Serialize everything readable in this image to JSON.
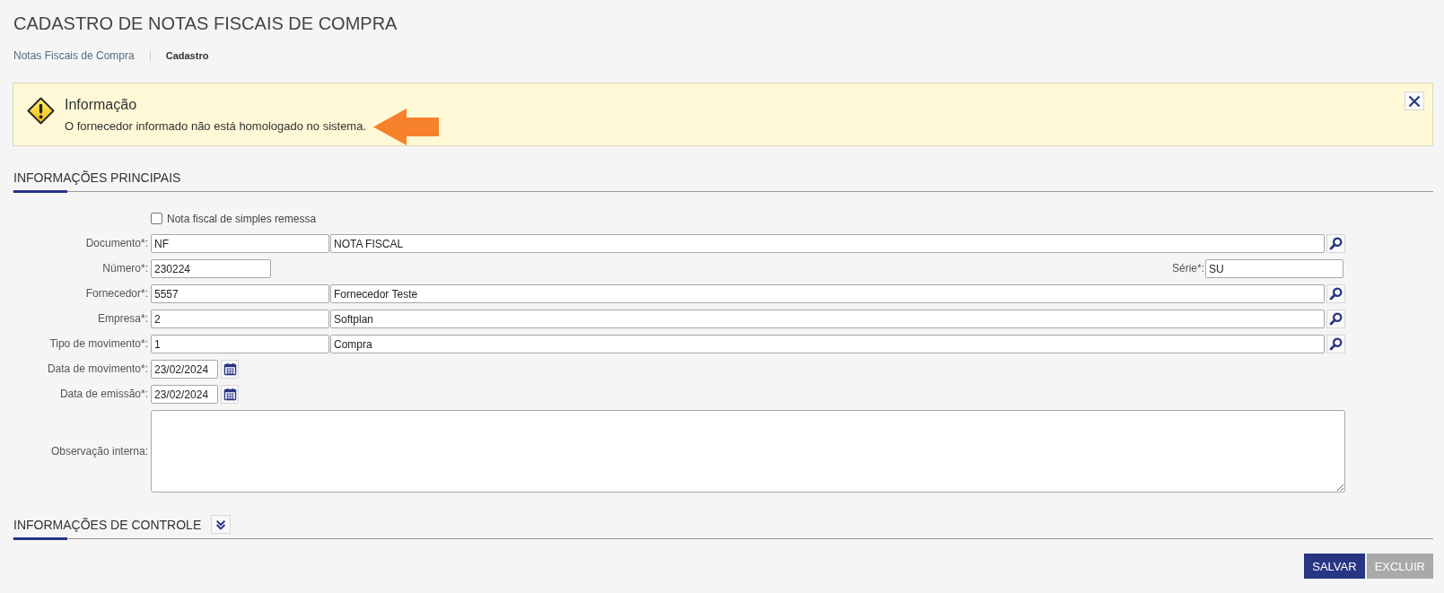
{
  "page": {
    "title": "CADASTRO DE NOTAS FISCAIS DE COMPRA"
  },
  "breadcrumb": [
    {
      "label": "Notas Fiscais de Compra",
      "current": false
    },
    {
      "label": "Cadastro",
      "current": true
    }
  ],
  "alert": {
    "title": "Informação",
    "message": "O fornecedor informado não está homologado no sistema."
  },
  "main_section": {
    "title": "INFORMAÇÕES PRINCIPAIS",
    "fields": [
      {
        "kind": "checkbox",
        "label": "Nota fiscal de simples remessa",
        "checked": false
      },
      {
        "kind": "lookup",
        "label": "Documento*:",
        "code": "NF",
        "description": "NOTA FISCAL"
      },
      {
        "kind": "split",
        "label": "Número*:",
        "value": "230224",
        "series_label": "Série*:",
        "series_value": "SU"
      },
      {
        "kind": "lookup",
        "label": "Fornecedor*:",
        "code": "5557",
        "description": "Fornecedor Teste"
      },
      {
        "kind": "lookup",
        "label": "Empresa*:",
        "code": "2",
        "description": "Softplan"
      },
      {
        "kind": "lookup",
        "label": "Tipo de movimento*:",
        "code": "1",
        "description": "Compra"
      },
      {
        "kind": "date",
        "label": "Data de movimento*:",
        "value": "23/02/2024"
      },
      {
        "kind": "date",
        "label": "Data de emissão*:",
        "value": "23/02/2024"
      },
      {
        "kind": "textarea",
        "label": "Observação interna:"
      }
    ]
  },
  "control_section": {
    "title": "INFORMAÇÕES DE CONTROLE",
    "expanded": false
  },
  "actions": [
    {
      "label": "SALVAR",
      "disabled": false
    },
    {
      "label": "EXCLUIR",
      "disabled": true
    }
  ]
}
